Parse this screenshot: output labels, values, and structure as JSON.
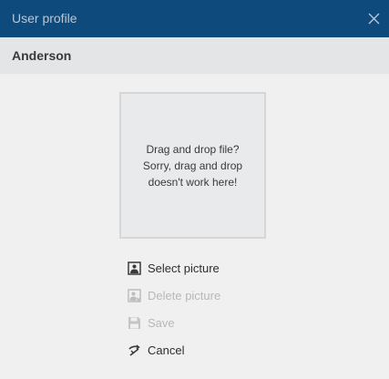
{
  "dialog": {
    "title": "User profile",
    "close_icon": "close-icon"
  },
  "profile": {
    "name": "Anderson"
  },
  "dropzone": {
    "line1": "Drag and drop file?",
    "line2": "Sorry, drag and drop",
    "line3": "doesn't work here!"
  },
  "actions": {
    "select_picture": {
      "label": "Select picture",
      "icon": "picture-icon",
      "enabled": true
    },
    "delete_picture": {
      "label": "Delete picture",
      "icon": "delete-picture-icon",
      "enabled": false
    },
    "save": {
      "label": "Save",
      "icon": "save-icon",
      "enabled": false
    },
    "cancel": {
      "label": "Cancel",
      "icon": "cancel-icon",
      "enabled": true
    }
  },
  "colors": {
    "titlebar": "#0f4a7c",
    "background": "#f0f0f0",
    "subheader": "#e4e5e7",
    "disabled_text": "#b8b8b8"
  }
}
